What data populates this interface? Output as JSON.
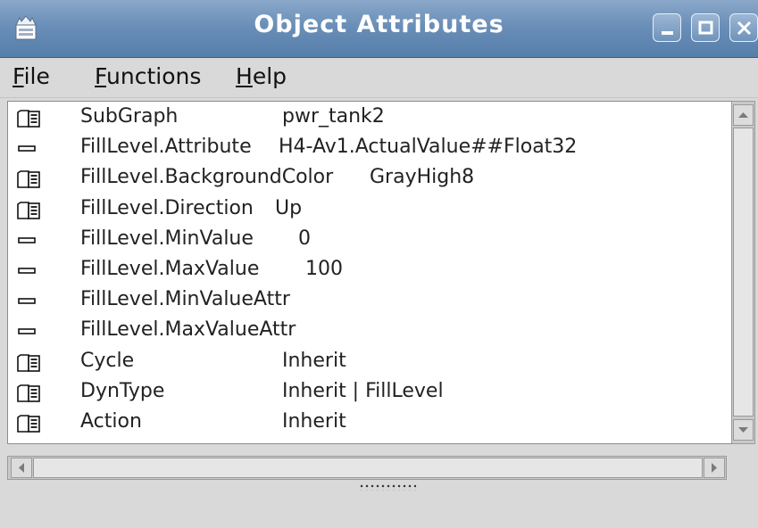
{
  "window": {
    "title": "Object Attributes"
  },
  "menu": {
    "file_underline": "F",
    "file_rest": "ile",
    "functions_underline": "F",
    "functions_rest": "unctions",
    "help_underline": "H",
    "help_rest": "elp"
  },
  "attributes": [
    {
      "icon": "folder-icon",
      "name": "SubGraph",
      "value": "pwr_tank2"
    },
    {
      "icon": "dash-icon",
      "name": "FillLevel.Attribute",
      "value": "H4-Av1.ActualValue##Float32"
    },
    {
      "icon": "folder-icon",
      "name": "FillLevel.BackgroundColor",
      "value": "GrayHigh8"
    },
    {
      "icon": "folder-icon",
      "name": "FillLevel.Direction",
      "value": "Up"
    },
    {
      "icon": "dash-icon",
      "name": "FillLevel.MinValue",
      "value": "0"
    },
    {
      "icon": "dash-icon",
      "name": "FillLevel.MaxValue",
      "value": "100"
    },
    {
      "icon": "dash-icon",
      "name": "FillLevel.MinValueAttr",
      "value": ""
    },
    {
      "icon": "dash-icon",
      "name": "FillLevel.MaxValueAttr",
      "value": ""
    },
    {
      "icon": "folder-icon",
      "name": "Cycle",
      "value": "Inherit"
    },
    {
      "icon": "folder-icon",
      "name": "DynType",
      "value": "Inherit | FillLevel"
    },
    {
      "icon": "folder-icon",
      "name": "Action",
      "value": "Inherit"
    }
  ],
  "colors": {
    "titlebar": "#6a8fb8",
    "background": "#d9d9d9",
    "list_background": "#ffffff"
  }
}
